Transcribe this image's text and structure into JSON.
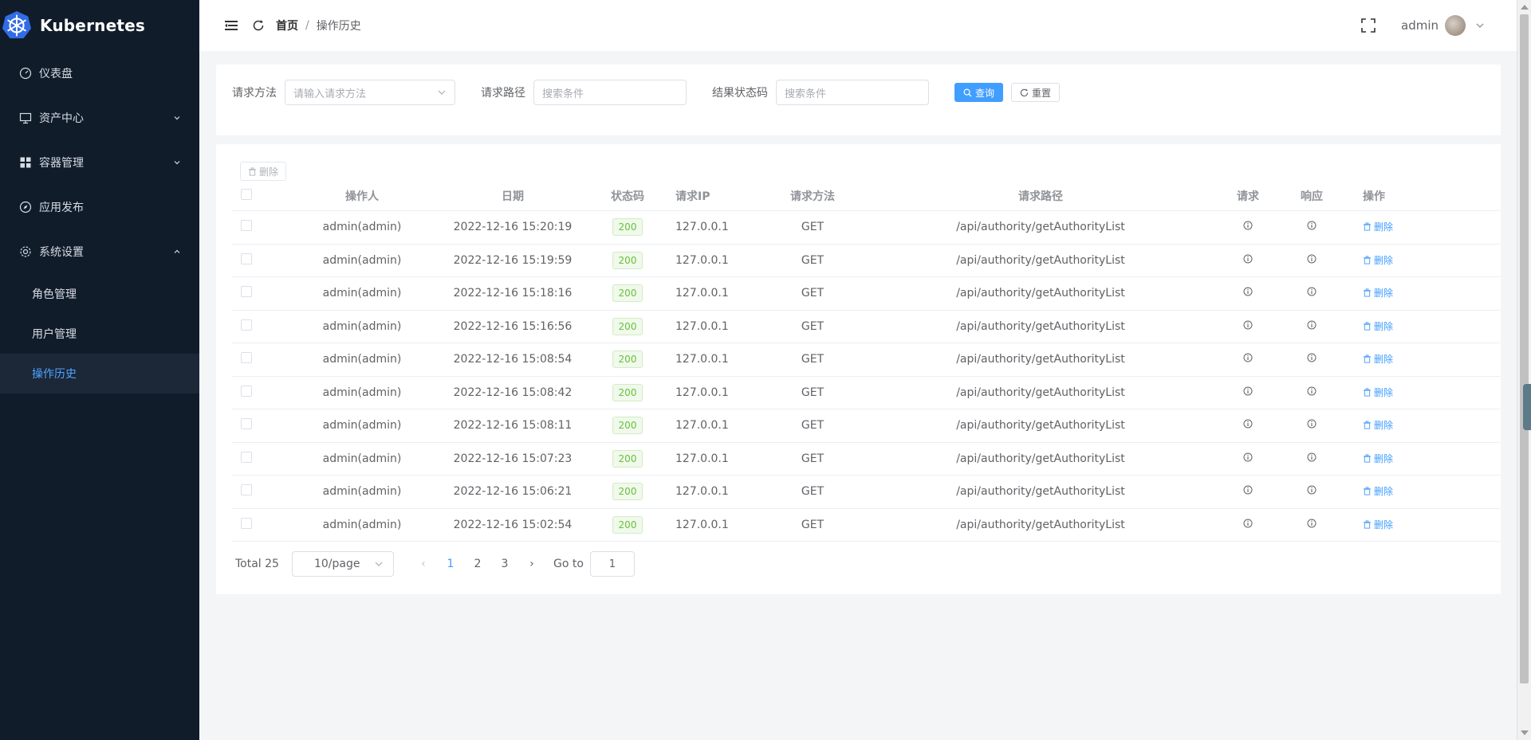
{
  "app": {
    "title": "Kubernetes"
  },
  "sidebar": {
    "items": [
      {
        "label": "仪表盘",
        "icon": "dashboard-icon"
      },
      {
        "label": "资产中心",
        "icon": "monitor-icon"
      },
      {
        "label": "容器管理",
        "icon": "grid-icon"
      },
      {
        "label": "应用发布",
        "icon": "compass-icon"
      },
      {
        "label": "系统设置",
        "icon": "gear-icon"
      }
    ],
    "submenu": [
      {
        "label": "角色管理"
      },
      {
        "label": "用户管理"
      },
      {
        "label": "操作历史",
        "active": true
      }
    ]
  },
  "header": {
    "breadcrumb_home": "首页",
    "breadcrumb_sep": "/",
    "breadcrumb_current": "操作历史",
    "user": "admin"
  },
  "search": {
    "method_label": "请求方法",
    "method_placeholder": "请输入请求方法",
    "path_label": "请求路径",
    "path_placeholder": "搜索条件",
    "status_label": "结果状态码",
    "status_placeholder": "搜索条件",
    "query_label": "查询",
    "reset_label": "重置"
  },
  "table": {
    "delete_label": "删除",
    "columns": [
      "操作人",
      "日期",
      "状态码",
      "请求IP",
      "请求方法",
      "请求路径",
      "请求",
      "响应",
      "操作"
    ],
    "rows": [
      {
        "operator": "admin(admin)",
        "date": "2022-12-16 15:20:19",
        "status": "200",
        "ip": "127.0.0.1",
        "method": "GET",
        "path": "/api/authority/getAuthorityList",
        "action": "删除"
      },
      {
        "operator": "admin(admin)",
        "date": "2022-12-16 15:19:59",
        "status": "200",
        "ip": "127.0.0.1",
        "method": "GET",
        "path": "/api/authority/getAuthorityList",
        "action": "删除"
      },
      {
        "operator": "admin(admin)",
        "date": "2022-12-16 15:18:16",
        "status": "200",
        "ip": "127.0.0.1",
        "method": "GET",
        "path": "/api/authority/getAuthorityList",
        "action": "删除"
      },
      {
        "operator": "admin(admin)",
        "date": "2022-12-16 15:16:56",
        "status": "200",
        "ip": "127.0.0.1",
        "method": "GET",
        "path": "/api/authority/getAuthorityList",
        "action": "删除"
      },
      {
        "operator": "admin(admin)",
        "date": "2022-12-16 15:08:54",
        "status": "200",
        "ip": "127.0.0.1",
        "method": "GET",
        "path": "/api/authority/getAuthorityList",
        "action": "删除"
      },
      {
        "operator": "admin(admin)",
        "date": "2022-12-16 15:08:42",
        "status": "200",
        "ip": "127.0.0.1",
        "method": "GET",
        "path": "/api/authority/getAuthorityList",
        "action": "删除"
      },
      {
        "operator": "admin(admin)",
        "date": "2022-12-16 15:08:11",
        "status": "200",
        "ip": "127.0.0.1",
        "method": "GET",
        "path": "/api/authority/getAuthorityList",
        "action": "删除"
      },
      {
        "operator": "admin(admin)",
        "date": "2022-12-16 15:07:23",
        "status": "200",
        "ip": "127.0.0.1",
        "method": "GET",
        "path": "/api/authority/getAuthorityList",
        "action": "删除"
      },
      {
        "operator": "admin(admin)",
        "date": "2022-12-16 15:06:21",
        "status": "200",
        "ip": "127.0.0.1",
        "method": "GET",
        "path": "/api/authority/getAuthorityList",
        "action": "删除"
      },
      {
        "operator": "admin(admin)",
        "date": "2022-12-16 15:02:54",
        "status": "200",
        "ip": "127.0.0.1",
        "method": "GET",
        "path": "/api/authority/getAuthorityList",
        "action": "删除"
      }
    ]
  },
  "pagination": {
    "total": "Total 25",
    "page_size": "10/page",
    "pages": [
      "1",
      "2",
      "3"
    ],
    "current": "1",
    "goto_label": "Go to",
    "goto_value": "1"
  },
  "colors": {
    "sidebar_bg": "#111c2b",
    "primary": "#409eff",
    "success": "#67c23a"
  }
}
